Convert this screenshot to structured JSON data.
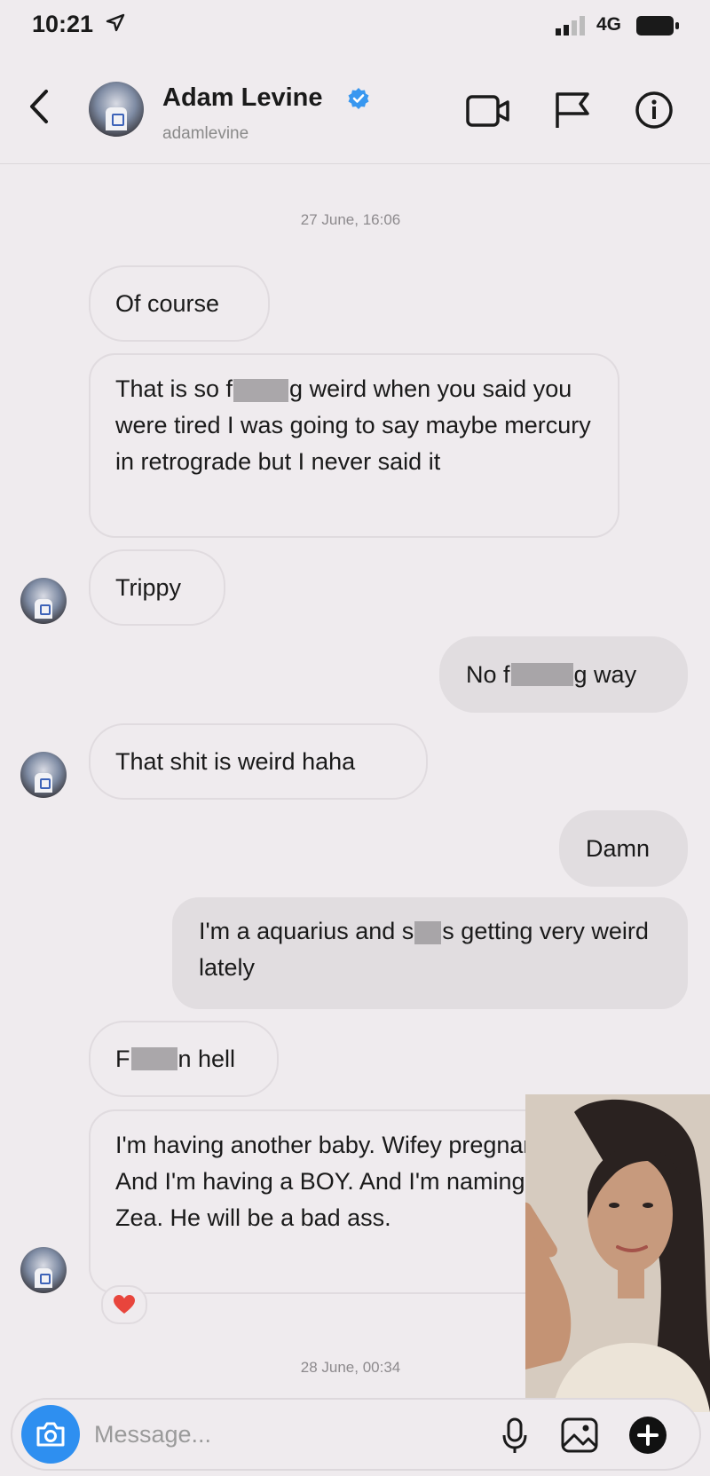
{
  "status_bar": {
    "time": "10:21",
    "network": "4G"
  },
  "header": {
    "name": "Adam Levine",
    "handle": "adamlevine"
  },
  "timestamps": [
    "27 June, 16:06",
    "28 June, 00:34"
  ],
  "messages": [
    {
      "parts": [
        "Of course"
      ]
    },
    {
      "parts": [
        "That is so f",
        "g weird when you said you were tired I was going to say maybe mercury in retrograde but I never said it"
      ]
    },
    {
      "parts": [
        "Trippy"
      ]
    },
    {
      "parts": [
        "No f",
        "g way"
      ]
    },
    {
      "parts": [
        "That shit is weird haha"
      ]
    },
    {
      "parts": [
        "Damn"
      ]
    },
    {
      "parts": [
        "I'm a aquarius and s",
        "s getting very weird lately"
      ]
    },
    {
      "parts": [
        "F",
        "n hell"
      ]
    },
    {
      "parts": [
        "I'm having another baby. Wifey pregnant! And I'm having a BOY. And I'm naming him Zea. He will be a bad ass."
      ]
    }
  ],
  "reaction": "heart",
  "composer": {
    "placeholder": "Message..."
  },
  "colors": {
    "verified": "#3897f0",
    "camera_button": "#2e8ff0",
    "heart": "#e8453c"
  }
}
